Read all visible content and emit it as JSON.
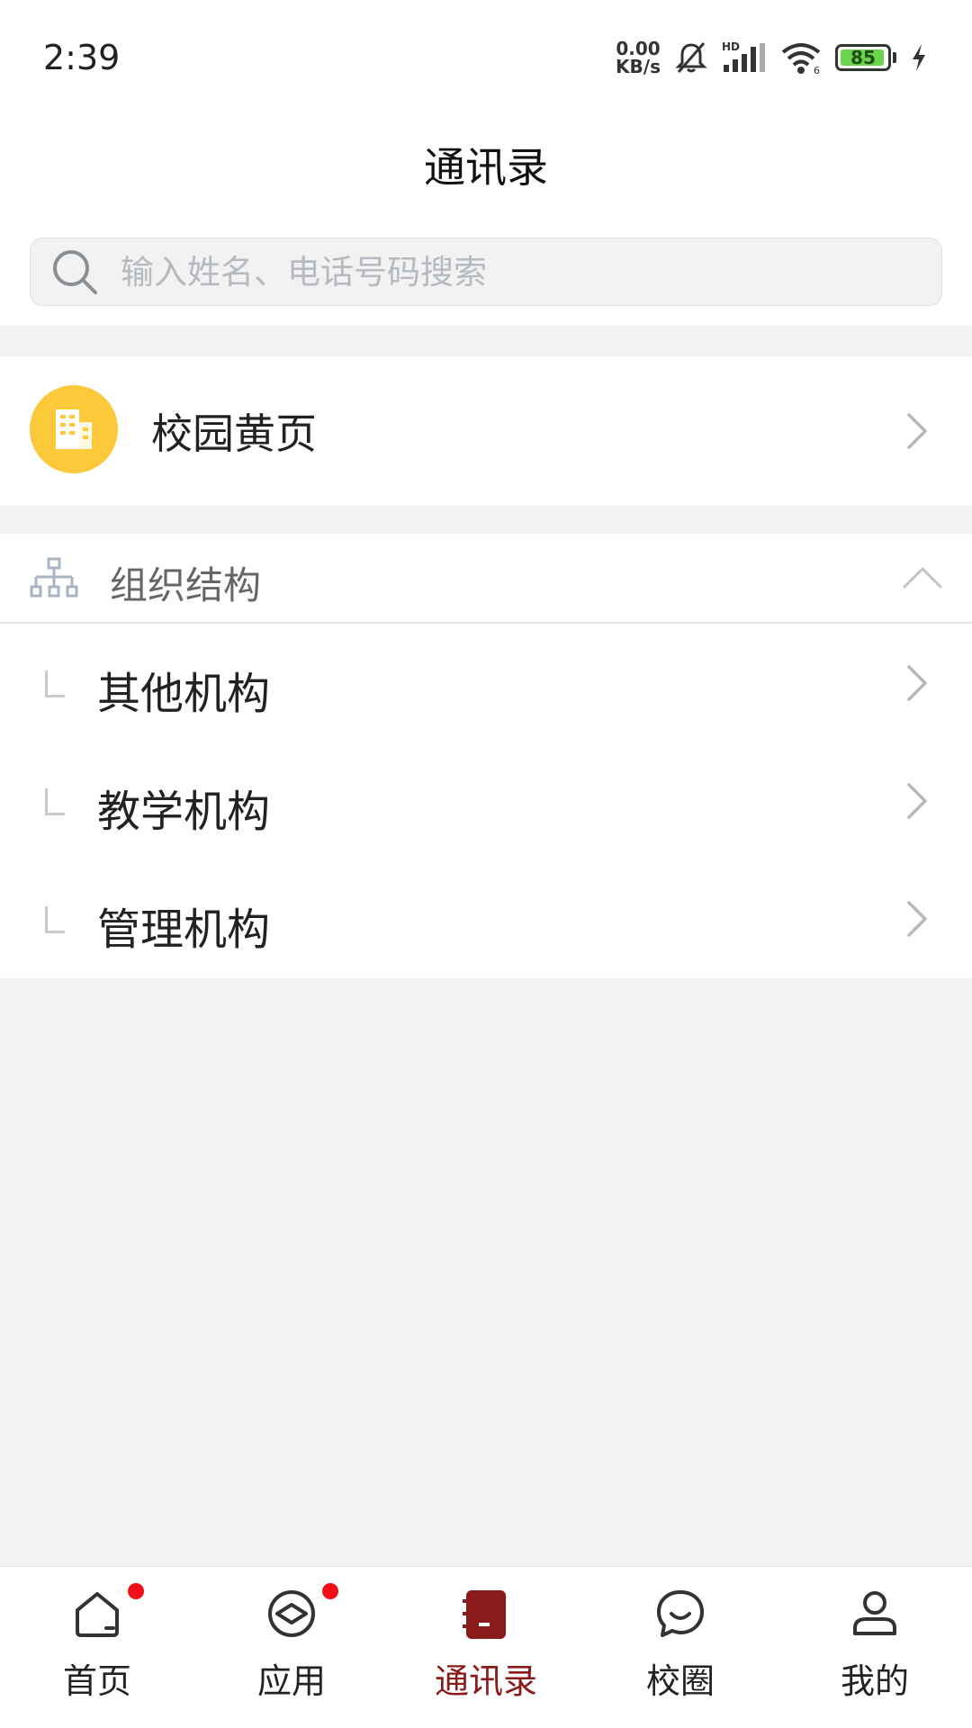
{
  "status_bar": {
    "time": "2:39",
    "net_speed_value": "0.00",
    "net_speed_unit": "KB/s",
    "signal_label": "HD",
    "battery_level": "85"
  },
  "header": {
    "title": "通讯录"
  },
  "search": {
    "placeholder": "输入姓名、电话号码搜索"
  },
  "yellow_pages": {
    "label": "校园黄页",
    "icon": "building-icon",
    "color": "#fcc93a"
  },
  "org": {
    "title": "组织结构",
    "expanded": true,
    "items": [
      {
        "label": "其他机构"
      },
      {
        "label": "教学机构"
      },
      {
        "label": "管理机构"
      }
    ]
  },
  "tabbar": {
    "active_color": "#8b1a1a",
    "tabs": [
      {
        "label": "首页",
        "icon": "home-icon",
        "badge": true
      },
      {
        "label": "应用",
        "icon": "apps-icon",
        "badge": true
      },
      {
        "label": "通讯录",
        "icon": "contacts-icon",
        "active": true
      },
      {
        "label": "校圈",
        "icon": "chat-bubble-icon"
      },
      {
        "label": "我的",
        "icon": "user-icon"
      }
    ]
  }
}
